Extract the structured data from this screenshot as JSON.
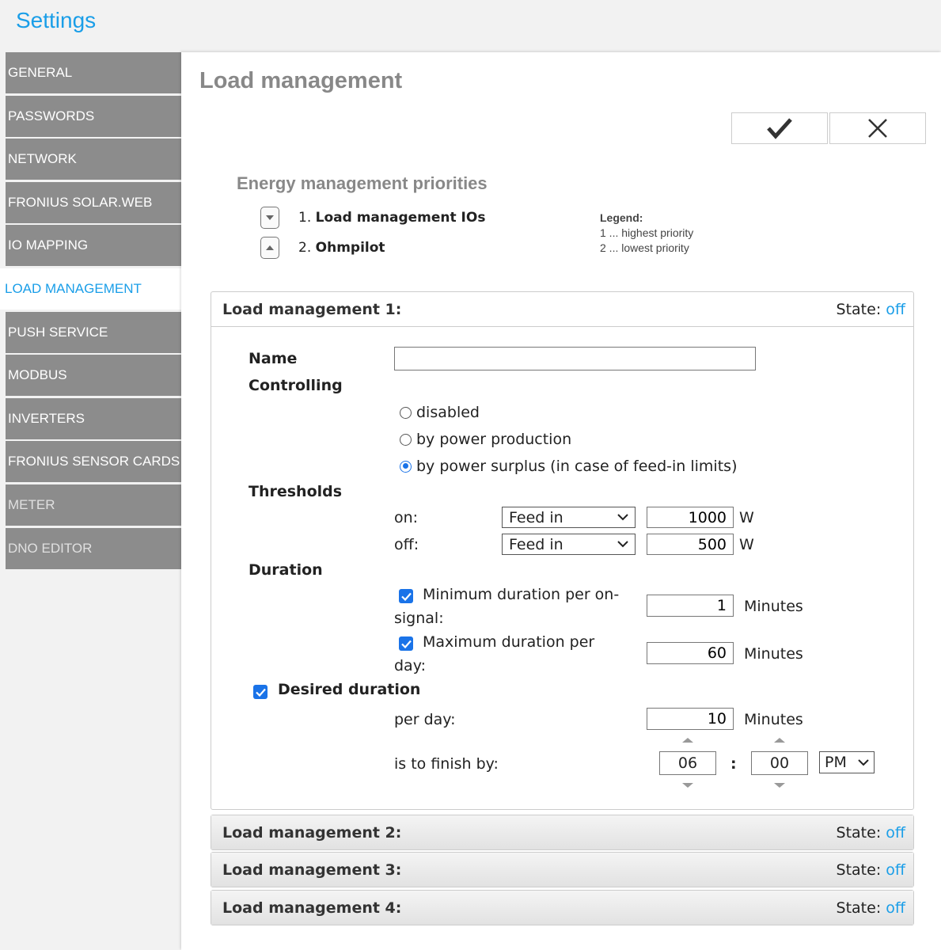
{
  "app": {
    "title": "Settings"
  },
  "sidebar": {
    "items": [
      {
        "label": "GENERAL"
      },
      {
        "label": "PASSWORDS"
      },
      {
        "label": "NETWORK"
      },
      {
        "label": "FRONIUS SOLAR.WEB"
      },
      {
        "label": "IO MAPPING"
      },
      {
        "label": "LOAD MANAGEMENT"
      },
      {
        "label": "PUSH SERVICE"
      },
      {
        "label": "MODBUS"
      },
      {
        "label": "INVERTERS"
      },
      {
        "label": "FRONIUS SENSOR CARDS"
      },
      {
        "label": "METER"
      },
      {
        "label": "DNO EDITOR"
      }
    ],
    "active": "LOAD MANAGEMENT"
  },
  "main": {
    "title": "Load management",
    "confirm_icon": "checkmark-icon",
    "cancel_icon": "close-icon"
  },
  "priorities": {
    "title": "Energy management priorities",
    "items": [
      {
        "num": "1.",
        "label": "Load management IOs",
        "arrow": "chevron-down-icon"
      },
      {
        "num": "2.",
        "label": "Ohmpilot",
        "arrow": "chevron-up-icon"
      }
    ],
    "legend": {
      "title": "Legend:",
      "line1": "1 ... highest priority",
      "line2": "2 ... lowest priority"
    }
  },
  "panels": [
    {
      "title": "Load management 1:",
      "state_label": "State:",
      "state_value": "off"
    },
    {
      "title": "Load management 2:",
      "state_label": "State:",
      "state_value": "off"
    },
    {
      "title": "Load management 3:",
      "state_label": "State:",
      "state_value": "off"
    },
    {
      "title": "Load management 4:",
      "state_label": "State:",
      "state_value": "off"
    }
  ],
  "form": {
    "name_label": "Name",
    "name_value": "",
    "controlling_label": "Controlling",
    "controlling_options": [
      {
        "label": "disabled",
        "checked": false
      },
      {
        "label": "by power production",
        "checked": false
      },
      {
        "label": "by power surplus (in case of feed-in limits)",
        "checked": true
      }
    ],
    "thresholds_label": "Thresholds",
    "on": {
      "label": "on:",
      "select": "Feed in",
      "value": "1000",
      "unit": "W"
    },
    "off": {
      "label": "off:",
      "select": "Feed in",
      "value": "500",
      "unit": "W"
    },
    "duration_label": "Duration",
    "min_duration": {
      "line1": "Minimum duration per on-",
      "line2": "signal:",
      "value": "1",
      "unit": "Minutes",
      "checked": true
    },
    "max_duration": {
      "line1": "Maximum duration per",
      "line2": "day:",
      "value": "60",
      "unit": "Minutes",
      "checked": true
    },
    "desired": {
      "label": "Desired duration",
      "checked": true
    },
    "per_day": {
      "label": "per day:",
      "value": "10",
      "unit": "Minutes"
    },
    "finish_by": {
      "label": "is to finish by:",
      "hour": "06",
      "separator": ":",
      "minute": "00",
      "ampm": "PM"
    }
  }
}
